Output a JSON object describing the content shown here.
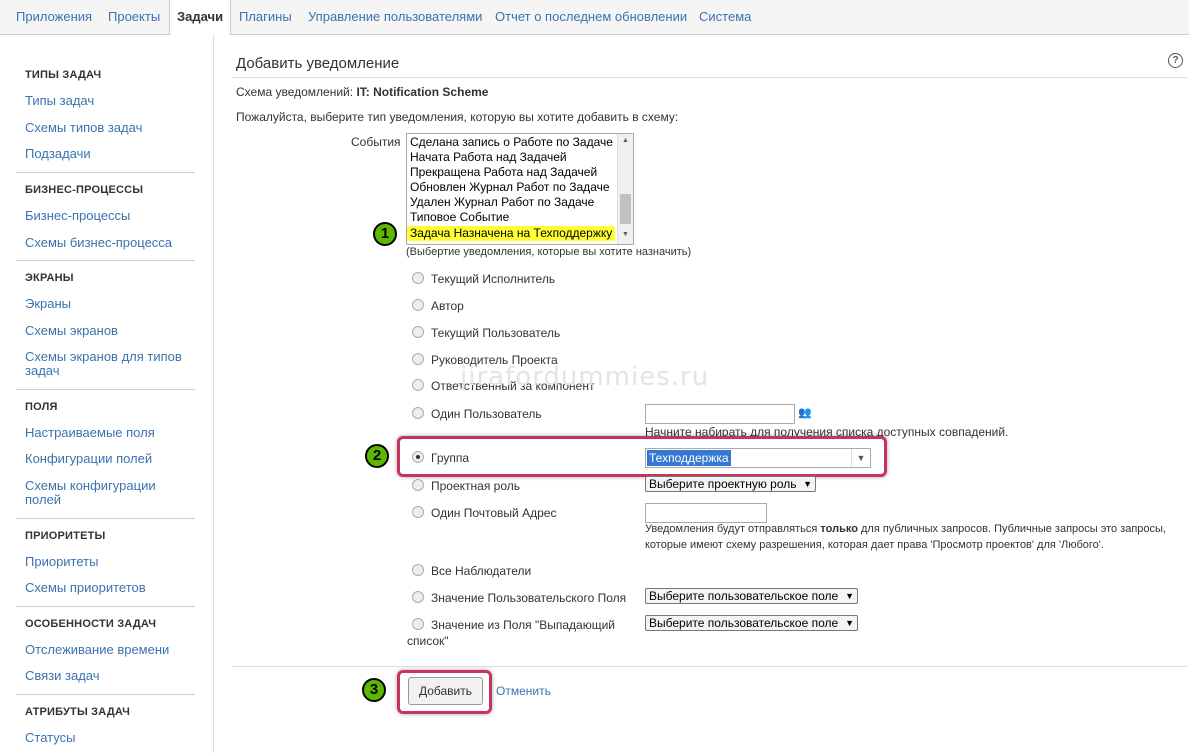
{
  "nav": {
    "tabs": [
      "Приложения",
      "Проекты",
      "Задачи",
      "Плагины",
      "Управление пользователями",
      "Отчет о последнем обновлении",
      "Система"
    ]
  },
  "sidebar": {
    "sections": [
      {
        "title": "ТИПЫ ЗАДАЧ",
        "items": [
          "Типы задач",
          "Схемы типов задач",
          "Подзадачи"
        ]
      },
      {
        "title": "БИЗНЕС-ПРОЦЕССЫ",
        "items": [
          "Бизнес-процессы",
          "Схемы бизнес-процесса"
        ]
      },
      {
        "title": "ЭКРАНЫ",
        "items": [
          "Экраны",
          "Схемы экранов",
          "Схемы экранов для типов задач"
        ]
      },
      {
        "title": "ПОЛЯ",
        "items": [
          "Настраиваемые поля",
          "Конфигурации полей",
          "Схемы конфигурации полей"
        ]
      },
      {
        "title": "ПРИОРИТЕТЫ",
        "items": [
          "Приоритеты",
          "Схемы приоритетов"
        ]
      },
      {
        "title": "ОСОБЕННОСТИ ЗАДАЧ",
        "items": [
          "Отслеживание времени",
          "Связи задач"
        ]
      },
      {
        "title": "АТРИБУТЫ ЗАДАЧ",
        "items": [
          "Статусы"
        ]
      }
    ]
  },
  "main": {
    "title": "Добавить уведомление",
    "scheme_label": "Схема уведомлений:",
    "scheme_name": "IT: Notification Scheme",
    "instruction": "Пожалуйста, выберите тип уведомления, которую вы хотите добавить в схему:",
    "events_label": "События",
    "events": [
      "Сделана запись о Работе по Задаче",
      "Начата Работа над Задачей",
      "Прекращена Работа над Задачей",
      "Обновлен Журнал Работ по Задаче",
      "Удален Журнал Работ по Задаче",
      "Типовое Событие",
      "Задача Назначена на Техподдержку"
    ],
    "events_hint": "(Выбертие уведомления, которые вы хотите назначить)",
    "recipients": {
      "current_assignee": "Текущий Исполнитель",
      "author": "Автор",
      "current_user": "Текущий Пользователь",
      "project_lead": "Руководитель Проекта",
      "component_lead": "Ответственный за компонент",
      "single_user": "Один Пользователь",
      "single_user_hint": "Начните набирать для получения списка доступных совпадений.",
      "group": "Группа",
      "group_value": "Техподдержка",
      "project_role": "Проектная роль",
      "project_role_select": "Выберите проектную роль",
      "single_email": "Один Почтовый Адрес",
      "email_hint_1": "Уведомления будут отправляться",
      "email_hint_bold": "только",
      "email_hint_2": "для публичных запросов. Публичные запросы это запросы,",
      "email_hint_3": "которые имеют схему разрешения, которая дает права 'Просмотр проектов' для 'Любого'.",
      "all_watchers": "Все Наблюдатели",
      "custom_field": "Значение Пользовательского Поля",
      "custom_field_select": "Выберите пользовательское поле",
      "dropdown_field_1": "Значение из Поля \"Выпадающий",
      "dropdown_field_2": "список\"",
      "dropdown_field_select": "Выберите пользовательское поле"
    },
    "add_button": "Добавить",
    "cancel_link": "Отменить"
  },
  "annotations": [
    "1",
    "2",
    "3"
  ],
  "watermark": "jirafordummies.ru",
  "colors": {
    "link": "#3b73af",
    "highlight_border": "#c7345a",
    "badge": "#5cb800",
    "event_selected": "#ffff33",
    "group_selected": "#3478d3"
  }
}
